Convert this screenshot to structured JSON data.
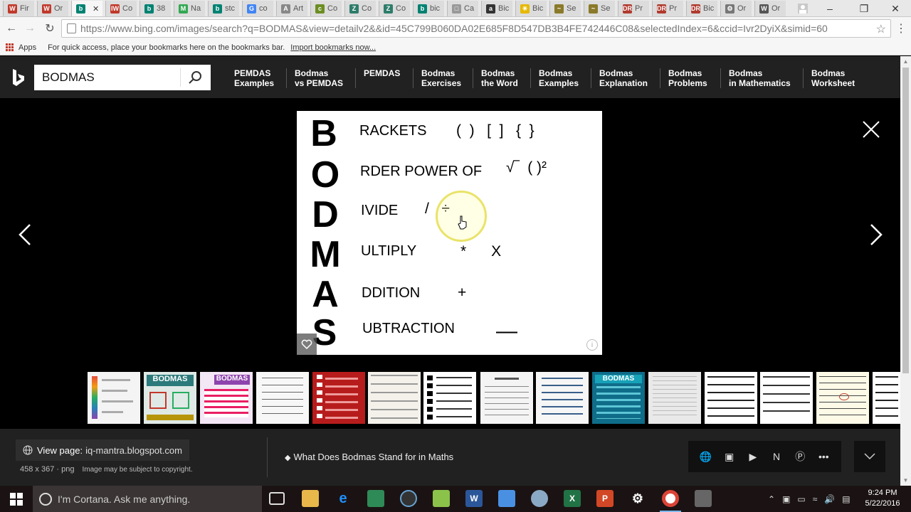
{
  "browser": {
    "tabs": [
      {
        "label": "Fir",
        "icon_color": "#c0392b",
        "icon": "W"
      },
      {
        "label": "Or",
        "icon_color": "#c0392b",
        "icon": "W"
      },
      {
        "label": "",
        "icon_color": "#008272",
        "icon": "b",
        "active": true
      },
      {
        "label": "Co",
        "icon_color": "#c0392b",
        "icon": "IW"
      },
      {
        "label": "38",
        "icon_color": "#008272",
        "icon": "b"
      },
      {
        "label": "Na",
        "icon_color": "#34a853",
        "icon": "M"
      },
      {
        "label": "stc",
        "icon_color": "#008272",
        "icon": "b"
      },
      {
        "label": "co",
        "icon_color": "#4285f4",
        "icon": "G"
      },
      {
        "label": "Art",
        "icon_color": "#888888",
        "icon": "A"
      },
      {
        "label": "Co",
        "icon_color": "#6b8e23",
        "icon": "c"
      },
      {
        "label": "Co",
        "icon_color": "#2e7d6b",
        "icon": "Z"
      },
      {
        "label": "Co",
        "icon_color": "#2e7d6b",
        "icon": "Z"
      },
      {
        "label": "bic",
        "icon_color": "#008272",
        "icon": "b"
      },
      {
        "label": "Ca",
        "icon_color": "#999999",
        "icon": "□"
      },
      {
        "label": "Bic",
        "icon_color": "#333333",
        "icon": "a"
      },
      {
        "label": "Bic",
        "icon_color": "#e6b800",
        "icon": "✳"
      },
      {
        "label": "Se",
        "icon_color": "#8a7a2a",
        "icon": "~"
      },
      {
        "label": "Se",
        "icon_color": "#8a7a2a",
        "icon": "~"
      },
      {
        "label": "Pr",
        "icon_color": "#b03a2e",
        "icon": "DR"
      },
      {
        "label": "Pr",
        "icon_color": "#b03a2e",
        "icon": "DR"
      },
      {
        "label": "Bic",
        "icon_color": "#b03a2e",
        "icon": "DR"
      },
      {
        "label": "Or",
        "icon_color": "#777777",
        "icon": "⚙"
      },
      {
        "label": "Or",
        "icon_color": "#555555",
        "icon": "W"
      }
    ],
    "url": "https://www.bing.com/images/search?q=BODMAS&view=detailv2&&id=45C799B060DA02E685F8D547DB3B4FE742446C08&selectedIndex=6&ccid=Ivr2DyiX&simid=60",
    "bookmarks": {
      "apps_label": "Apps",
      "hint": "For quick access, place your bookmarks here on the bookmarks bar.",
      "import_link": "Import bookmarks now..."
    }
  },
  "bing": {
    "search_value": "BODMAS",
    "related": [
      {
        "line1": "PEMDAS",
        "line2": "Examples"
      },
      {
        "line1": "Bodmas",
        "line2": "vs PEMDAS"
      },
      {
        "line1": "PEMDAS",
        "line2": ""
      },
      {
        "line1": "Bodmas",
        "line2": "Exercises"
      },
      {
        "line1": "Bodmas",
        "line2": "the Word"
      },
      {
        "line1": "Bodmas",
        "line2": "Examples"
      },
      {
        "line1": "Bodmas",
        "line2": "Explanation"
      },
      {
        "line1": "Bodmas",
        "line2": "Problems"
      },
      {
        "line1": "Bodmas",
        "line2": "in Mathematics"
      },
      {
        "line1": "Bodmas",
        "line2": "Worksheet"
      }
    ]
  },
  "image": {
    "rows": [
      {
        "letter": "B",
        "word": "RACKETS",
        "symbols": "(  )   [  ]   {  }"
      },
      {
        "letter": "O",
        "word": "RDER POWER OF",
        "symbols": "√‾  ( )²"
      },
      {
        "letter": "D",
        "word": "IVIDE",
        "symbols": "/   ÷"
      },
      {
        "letter": "M",
        "word": "ULTIPLY",
        "symbols": "*      X"
      },
      {
        "letter": "A",
        "word": "DDITION",
        "symbols": "+"
      },
      {
        "letter": "S",
        "word": "UBTRACTION",
        "symbols": "—"
      }
    ],
    "info_icon": "i"
  },
  "details": {
    "view_page_label": "View page:",
    "view_page_domain": "iq-mantra.blogspot.com",
    "dimensions": "458 x 367 · png",
    "copyright": "Image may be subject to copyright.",
    "title": "What Does Bodmas Stand for in Maths"
  },
  "taskbar": {
    "cortana_placeholder": "I'm Cortana. Ask me anything.",
    "time": "9:24 PM",
    "date": "5/22/2016"
  },
  "colors": {
    "bing_bar": "#212121",
    "stage": "#000000",
    "taskbar": "#1b1313"
  }
}
